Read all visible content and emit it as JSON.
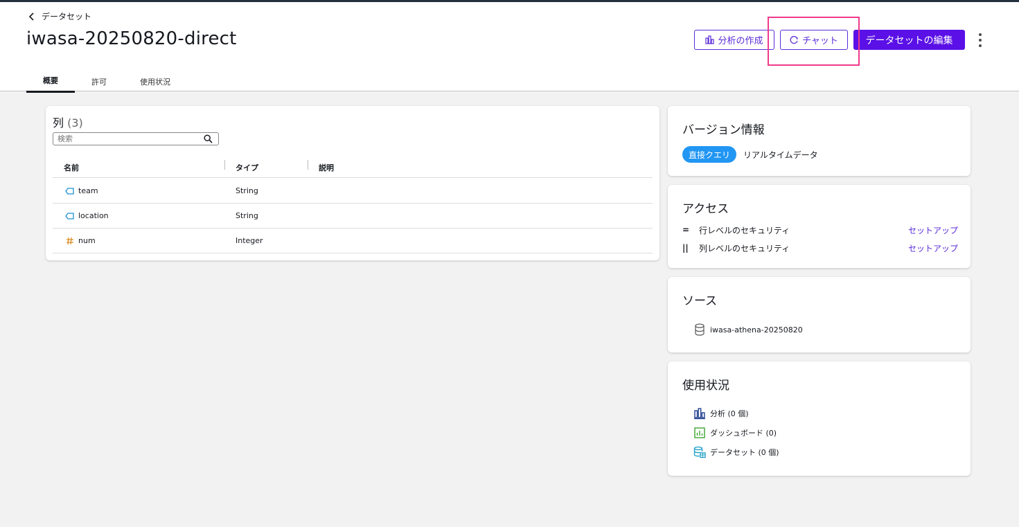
{
  "header": {
    "back_label": "データセット",
    "title": "iwasa-20250820-direct",
    "buttons": {
      "analysis": "分析の作成",
      "chat": "チャット",
      "edit": "データセットの編集"
    },
    "tabs": [
      {
        "label": "概要",
        "active": true
      },
      {
        "label": "許可",
        "active": false
      },
      {
        "label": "使用状況",
        "active": false
      }
    ]
  },
  "columns": {
    "title": "列",
    "count": "(3)",
    "search_placeholder": "検索",
    "headers": {
      "name": "名前",
      "type": "タイプ",
      "description": "説明"
    },
    "rows": [
      {
        "icon": "string-tag-icon",
        "name": "team",
        "type": "String"
      },
      {
        "icon": "string-tag-icon",
        "name": "location",
        "type": "String"
      },
      {
        "icon": "hash-icon",
        "name": "num",
        "type": "Integer"
      }
    ]
  },
  "version": {
    "title": "バージョン情報",
    "badge": "直接クエリ",
    "desc": "リアルタイムデータ"
  },
  "access": {
    "title": "アクセス",
    "rows": [
      {
        "icon": "row-security-icon",
        "glyph": "=",
        "label": "行レベルのセキュリティ",
        "link": "セットアップ"
      },
      {
        "icon": "column-security-icon",
        "glyph": "||",
        "label": "列レベルのセキュリティ",
        "link": "セットアップ"
      }
    ]
  },
  "source": {
    "title": "ソース",
    "name": "iwasa-athena-20250820"
  },
  "usage": {
    "title": "使用状況",
    "items": [
      {
        "icon": "analysis-icon",
        "label": "分析 (0 個)"
      },
      {
        "icon": "dashboard-icon",
        "label": "ダッシュボード (0)"
      },
      {
        "icon": "dataset-icon",
        "label": "データセット (0 個)"
      }
    ]
  },
  "colors": {
    "accent": "#5a2bd8",
    "primary_button": "#5a10e6",
    "badge": "#2196f3",
    "highlight": "#ef3a8a"
  }
}
